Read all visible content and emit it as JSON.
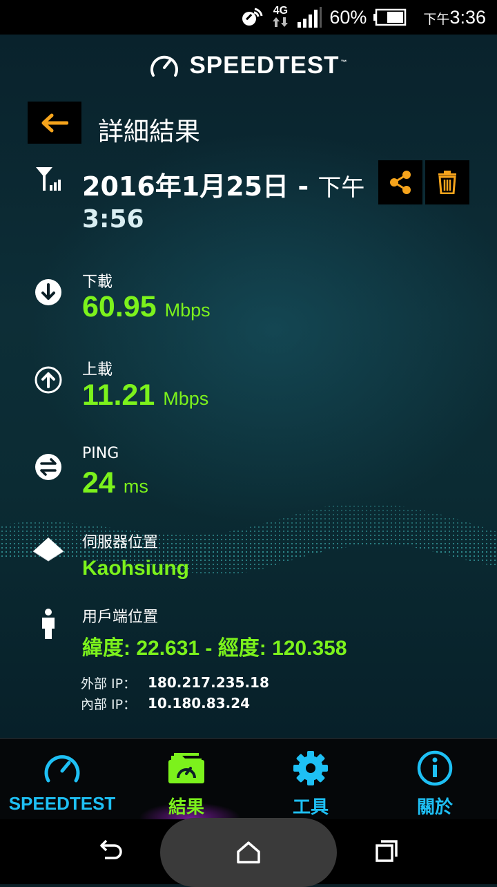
{
  "status_bar": {
    "network": "4G",
    "battery": "60%",
    "time_prefix": "下午",
    "time": "3:36"
  },
  "header": {
    "logo": "SPEEDTEST",
    "logo_tm": "™"
  },
  "page": {
    "title": "詳細結果"
  },
  "result": {
    "date": "2016年1月25日",
    "separator": "-",
    "ampm": "下午",
    "time": "3:56",
    "download": {
      "label": "下載",
      "value": "60.95",
      "unit": "Mbps"
    },
    "upload": {
      "label": "上載",
      "value": "11.21",
      "unit": "Mbps"
    },
    "ping": {
      "label": "PING",
      "value": "24",
      "unit": "ms"
    },
    "server": {
      "label": "伺服器位置",
      "value": "Kaohsiung"
    },
    "client": {
      "label": "用戶端位置",
      "value": "緯度: 22.631 - 經度: 120.358"
    },
    "external_ip": {
      "label": "外部 IP：",
      "value": "180.217.235.18"
    },
    "internal_ip": {
      "label": "內部 IP：",
      "value": "10.180.83.24"
    }
  },
  "nav": {
    "items": [
      {
        "label": "SPEEDTEST",
        "icon": "speedometer-icon"
      },
      {
        "label": "結果",
        "icon": "results-folder-icon",
        "active": true
      },
      {
        "label": "工具",
        "icon": "gear-icon"
      },
      {
        "label": "關於",
        "icon": "info-icon"
      }
    ]
  },
  "colors": {
    "accent_green": "#7cf21c",
    "accent_orange": "#f6a41c",
    "accent_blue": "#1ec0f5"
  }
}
